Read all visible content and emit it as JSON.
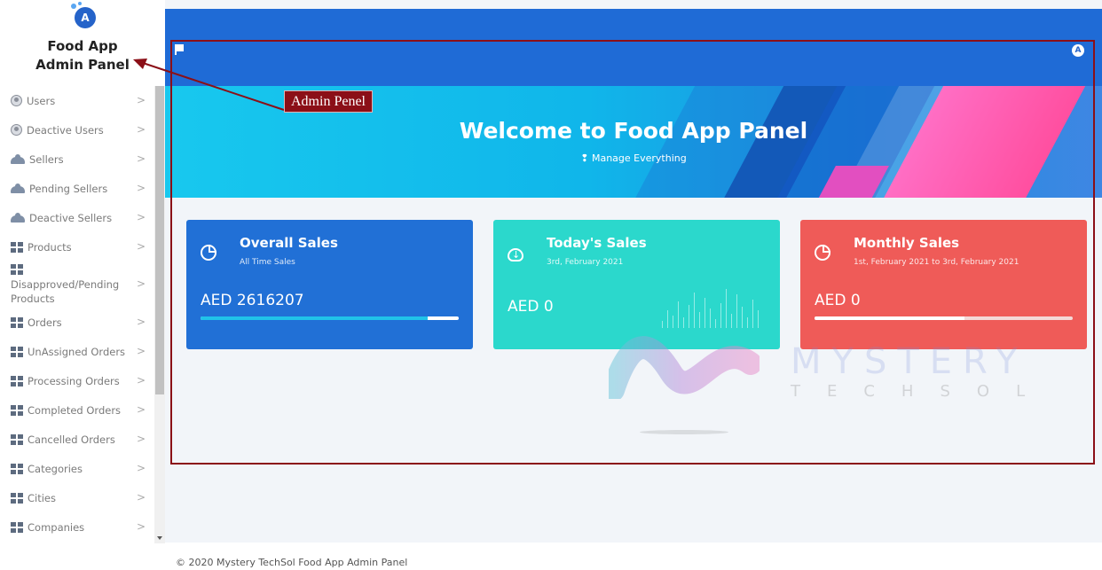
{
  "brand": {
    "logo_letter": "A",
    "title": "Food App\nAdmin Panel"
  },
  "sidebar": {
    "items": [
      {
        "label": "Users",
        "icon": "user-circle-icon"
      },
      {
        "label": "Deactive Users",
        "icon": "user-circle-icon"
      },
      {
        "label": "Sellers",
        "icon": "users-group-icon"
      },
      {
        "label": "Pending Sellers",
        "icon": "users-group-icon"
      },
      {
        "label": "Deactive Sellers",
        "icon": "users-group-icon"
      },
      {
        "label": "Products",
        "icon": "grid-icon"
      },
      {
        "label": "Disapproved/Pending Products",
        "icon": "grid-icon"
      },
      {
        "label": "Orders",
        "icon": "grid-icon"
      },
      {
        "label": "UnAssigned Orders",
        "icon": "grid-icon"
      },
      {
        "label": "Processing Orders",
        "icon": "grid-icon"
      },
      {
        "label": "Completed Orders",
        "icon": "grid-icon"
      },
      {
        "label": "Cancelled Orders",
        "icon": "grid-icon"
      },
      {
        "label": "Categories",
        "icon": "grid-icon"
      },
      {
        "label": "Cities",
        "icon": "grid-icon"
      },
      {
        "label": "Companies",
        "icon": "grid-icon"
      }
    ],
    "chevron": ">"
  },
  "topbar": {
    "avatar_letter": "A"
  },
  "hero": {
    "title": "Welcome to Food App Panel",
    "subtitle": "❢ Manage Everything"
  },
  "cards": {
    "overall": {
      "title": "Overall Sales",
      "subtitle": "All Time Sales",
      "value": "AED 2616207",
      "progress": 0.88,
      "color": "#2170d6"
    },
    "today": {
      "title": "Today's Sales",
      "subtitle": "3rd, February 2021",
      "value": "AED 0",
      "color": "#2bd8cc"
    },
    "monthly": {
      "title": "Monthly Sales",
      "subtitle": "1st, February 2021 to 3rd, February 2021",
      "value": "AED 0",
      "progress": 0.58,
      "color": "#ef5b58"
    }
  },
  "watermark": {
    "name": "MYSTERY",
    "sub": "TECHSOL"
  },
  "annotation": {
    "label": "Admin Penel",
    "color": "#8b0f17"
  },
  "footer": {
    "text": "© 2020 Mystery TechSol Food App Admin Panel"
  }
}
